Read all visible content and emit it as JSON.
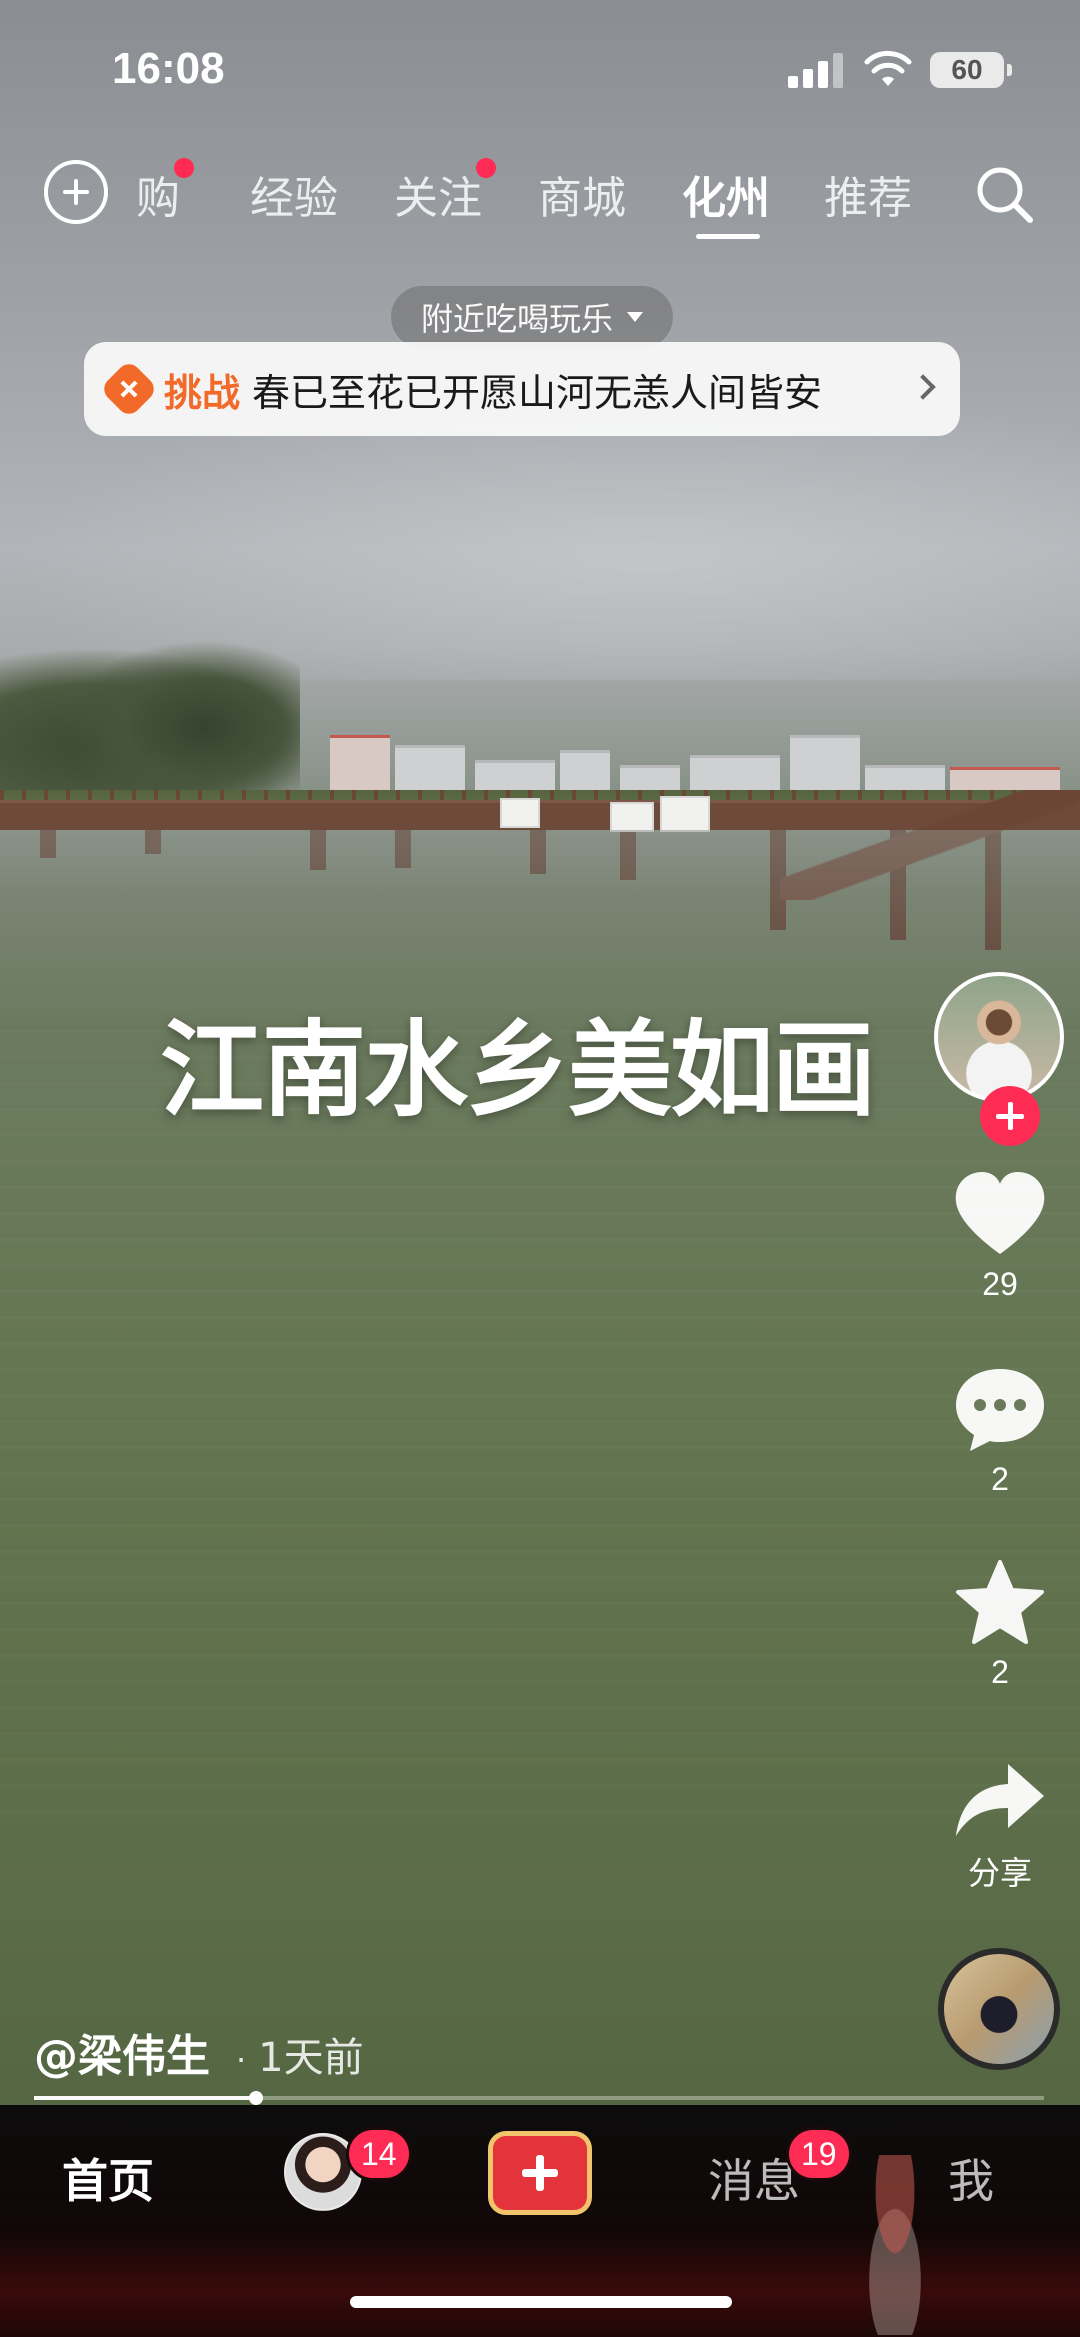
{
  "status_bar": {
    "time": "16:08",
    "battery": "60"
  },
  "top_tabs": [
    {
      "label": "购",
      "dot": true
    },
    {
      "label": "经验",
      "dot": false
    },
    {
      "label": "关注",
      "dot": true
    },
    {
      "label": "商城",
      "dot": false
    },
    {
      "label": "化州",
      "dot": false,
      "active": true
    },
    {
      "label": "推荐",
      "dot": false
    }
  ],
  "nearby_filter": {
    "label": "附近吃喝玩乐"
  },
  "challenge": {
    "tag": "挑战",
    "title": "春已至花已开愿山河无恙人间皆安"
  },
  "video": {
    "caption": "江南水乡美如画",
    "progress": 0.22
  },
  "actions": {
    "likes": "29",
    "comments": "2",
    "favorites": "2",
    "share_label": "分享"
  },
  "author": {
    "handle": "@梁伟生",
    "separator": "·",
    "posted": "1天前"
  },
  "bottom_tabs": {
    "home": "首页",
    "friends_badge": "14",
    "messages": "消息",
    "messages_badge": "19",
    "me": "我"
  },
  "colors": {
    "accent": "#fe2c55",
    "challenge": "#f26a2a",
    "create_border": "#f2c46b"
  }
}
